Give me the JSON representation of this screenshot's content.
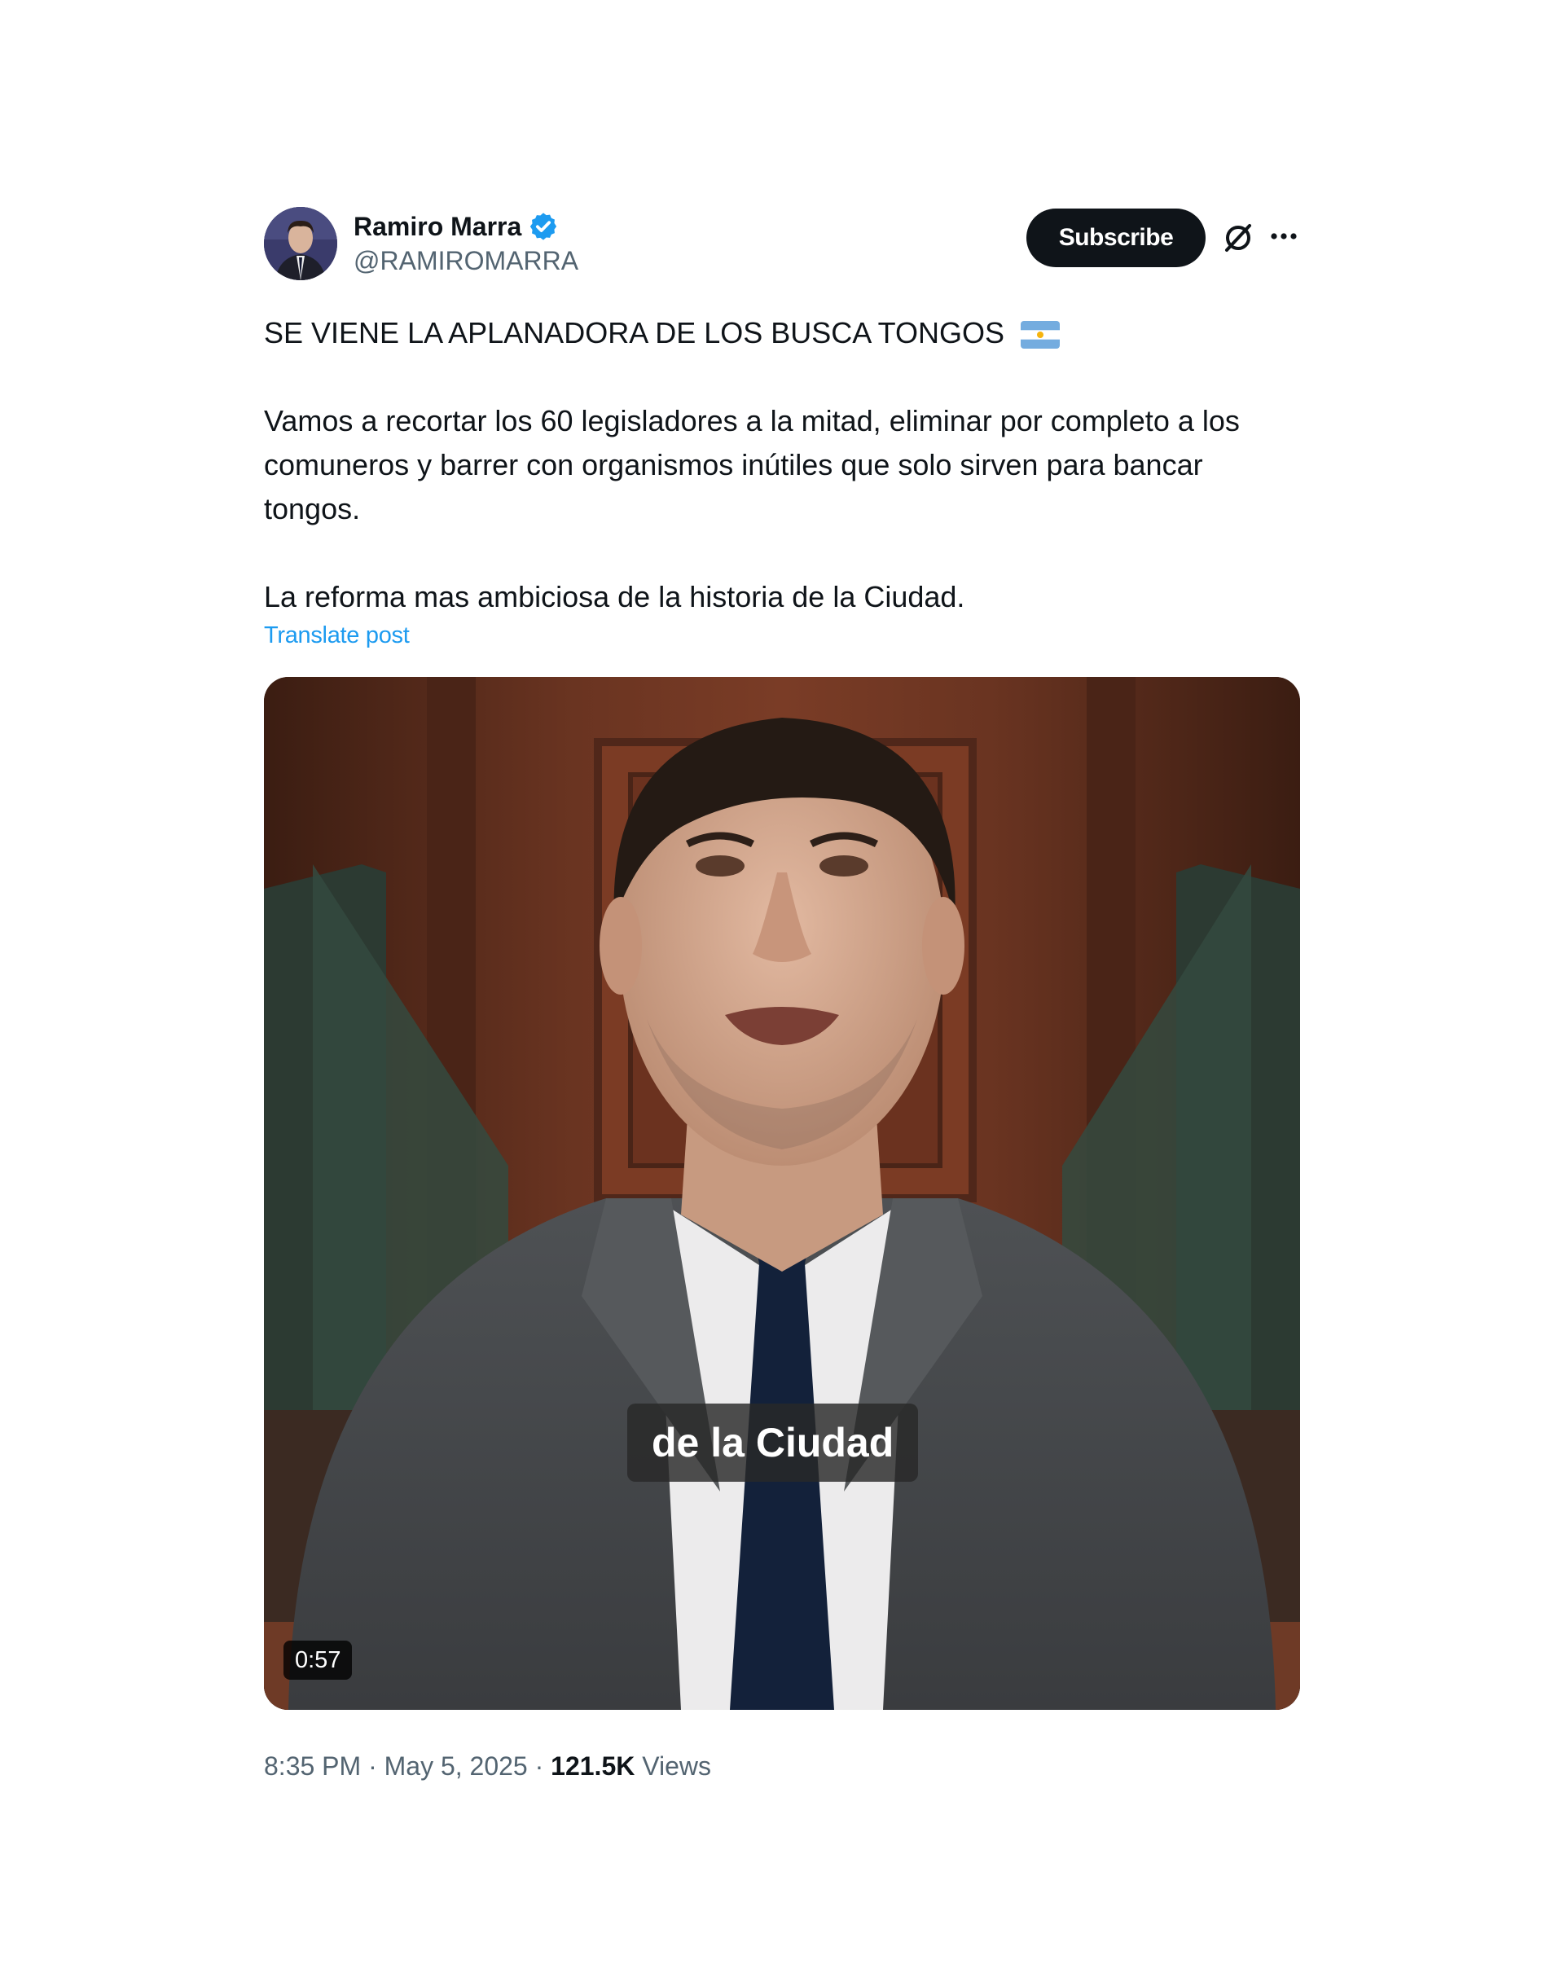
{
  "author": {
    "display_name": "Ramiro Marra",
    "handle": "@RAMIROMARRA",
    "verified": true
  },
  "actions": {
    "subscribe_label": "Subscribe"
  },
  "post": {
    "line1": "SE VIENE LA APLANADORA DE LOS BUSCA TONGOS",
    "line1_emoji": "argentina-flag-emoji",
    "paragraph2": "Vamos a recortar los 60 legisladores a la mitad, eliminar por completo a los comuneros y barrer con organismos inútiles que solo sirven para bancar tongos.",
    "paragraph3": "La reforma mas ambiciosa de la historia de la Ciudad.",
    "translate_label": "Translate post"
  },
  "media": {
    "caption": "de la Ciudad",
    "duration": "0:57"
  },
  "meta": {
    "time": "8:35 PM",
    "separator": "·",
    "date": "May 5, 2025",
    "views_count": "121.5K",
    "views_label": "Views"
  },
  "colors": {
    "link": "#1d9bf0",
    "verified": "#1d9bf0",
    "secondary_text": "#536471",
    "primary_text": "#0f1419"
  }
}
